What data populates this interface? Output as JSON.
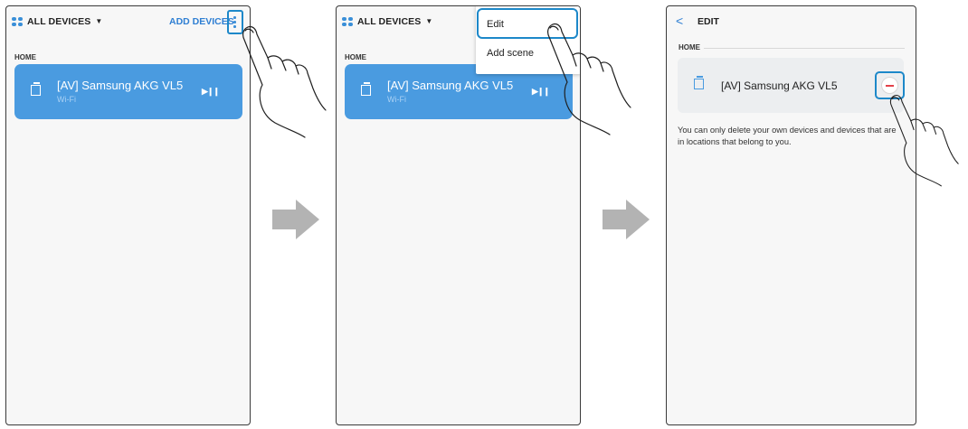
{
  "panel1": {
    "title": "ALL DEVICES",
    "add_devices": "ADD DEVICES",
    "section": "HOME",
    "device": {
      "name": "[AV] Samsung AKG VL5",
      "connection": "Wi-Fi",
      "control_icon": "play-pause-icon"
    }
  },
  "panel2": {
    "title": "ALL DEVICES",
    "section": "HOME",
    "menu": {
      "edit": "Edit",
      "add_scene": "Add scene"
    },
    "device": {
      "name": "[AV] Samsung AKG VL5",
      "connection": "Wi-Fi",
      "control_icon": "play-pause-icon"
    }
  },
  "panel3": {
    "title": "EDIT",
    "section": "HOME",
    "device": {
      "name": "[AV] Samsung AKG VL5"
    },
    "notice": "You can only delete your own devices and devices that are in locations that belong to you."
  },
  "colors": {
    "accent": "#1d88c9",
    "card": "#4a9be0",
    "remove": "#e3424a",
    "arrow": "#b3b3b3"
  }
}
